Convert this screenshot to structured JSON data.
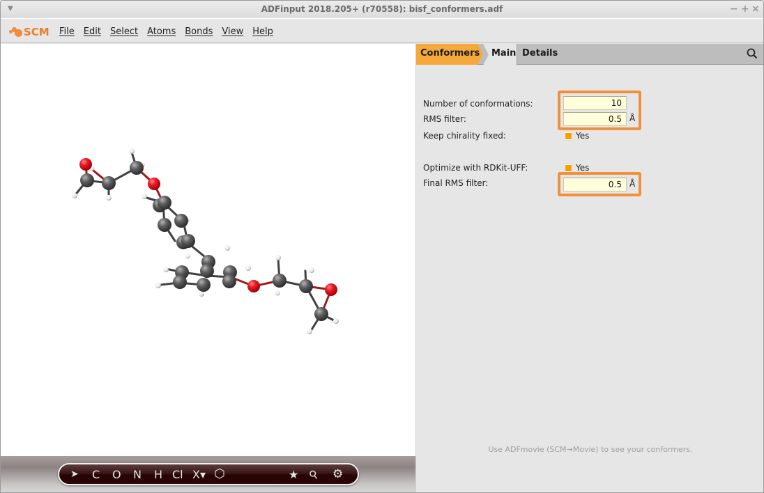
{
  "window": {
    "title": "ADFinput 2018.205+ (r70558): bisf_conformers.adf",
    "controls": [
      "−",
      "+",
      "×"
    ]
  },
  "menubar": {
    "logo": "SCM",
    "items": [
      "File",
      "Edit",
      "Select",
      "Atoms",
      "Bonds",
      "View",
      "Help"
    ]
  },
  "panel": {
    "tabs": {
      "conformers": "Conformers",
      "main": "Main",
      "details": "Details"
    },
    "fields": {
      "num_conformations": {
        "label": "Number of conformations:",
        "value": "10"
      },
      "rms_filter": {
        "label": "RMS filter:",
        "value": "0.5",
        "unit": "Å"
      },
      "keep_chirality": {
        "label": "Keep chirality fixed:",
        "checked": true,
        "option": "Yes"
      },
      "optimize_rdkit": {
        "label": "Optimize with RDKit-UFF:",
        "checked": true,
        "option": "Yes"
      },
      "final_rms_filter": {
        "label": "Final RMS filter:",
        "value": "0.5",
        "unit": "Å"
      }
    },
    "hint": "Use ADFmovie (SCM→Movie) to see your conformers."
  },
  "toolbar": {
    "tools": [
      {
        "name": "select-arrow-tool",
        "glyph": "➤"
      },
      {
        "name": "carbon-tool",
        "glyph": "C"
      },
      {
        "name": "oxygen-tool",
        "glyph": "O"
      },
      {
        "name": "nitrogen-tool",
        "glyph": "N"
      },
      {
        "name": "hydrogen-tool",
        "glyph": "H"
      },
      {
        "name": "chlorine-tool",
        "glyph": "Cl"
      },
      {
        "name": "other-element-tool",
        "glyph": "X▾"
      },
      {
        "name": "ring-tool",
        "glyph": "⬡"
      },
      {
        "name": "favorites-tool",
        "glyph": "★"
      },
      {
        "name": "search-tool",
        "glyph": "⚲"
      },
      {
        "name": "settings-tool",
        "glyph": "⚙"
      }
    ]
  },
  "colors": {
    "accent": "#f5a93a",
    "highlight": "#f0903a",
    "field_bg": "#ffffdb",
    "oxygen": "#e8202a",
    "carbon": "#5a5a5a",
    "hydrogen": "#f0f0f0"
  }
}
